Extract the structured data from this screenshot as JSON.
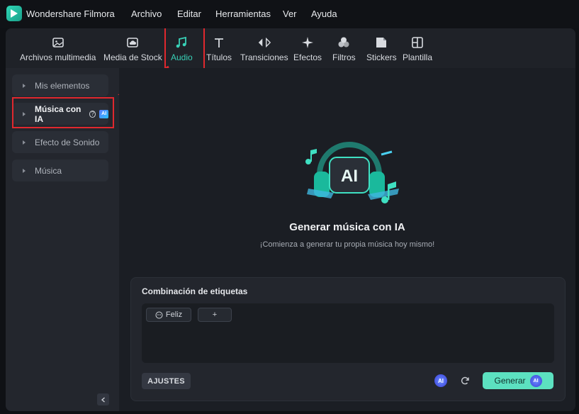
{
  "app": {
    "title": "Wondershare Filmora"
  },
  "menu": [
    "Archivo",
    "Editar",
    "Herramientas",
    "Ver",
    "Ayuda"
  ],
  "toolbar": {
    "items": [
      {
        "label": "Archivos multimedia",
        "icon": "media-icon"
      },
      {
        "label": "Media de Stock",
        "icon": "stock-cloud-icon"
      },
      {
        "label": "Audio",
        "icon": "music-note-icon",
        "active": true
      },
      {
        "label": "Títulos",
        "icon": "title-t-icon"
      },
      {
        "label": "Transiciones",
        "icon": "transition-icon"
      },
      {
        "label": "Efectos",
        "icon": "sparkle-icon"
      },
      {
        "label": "Filtros",
        "icon": "filter-icon"
      },
      {
        "label": "Stickers",
        "icon": "sticker-icon"
      },
      {
        "label": "Plantilla",
        "icon": "template-icon"
      }
    ]
  },
  "sidebar": {
    "items": [
      {
        "label": "Mis elementos"
      },
      {
        "label": "Música con IA",
        "active": true,
        "badge": "AI"
      },
      {
        "label": "Efecto de Sonido"
      },
      {
        "label": "Música"
      }
    ]
  },
  "main": {
    "hero_text": "AI",
    "title": "Generar música con IA",
    "subtitle": "¡Comienza a generar tu propia música hoy mismo!",
    "panel": {
      "title": "Combinación de etiquetas",
      "tags": [
        "Feliz",
        "+"
      ],
      "settings_label": "AJUSTES",
      "ai_badge": "AI",
      "generate_label": "Generar"
    }
  },
  "colors": {
    "accent": "#38d1b7",
    "highlight": "#e0282e",
    "generate": "#5ce1c0"
  }
}
